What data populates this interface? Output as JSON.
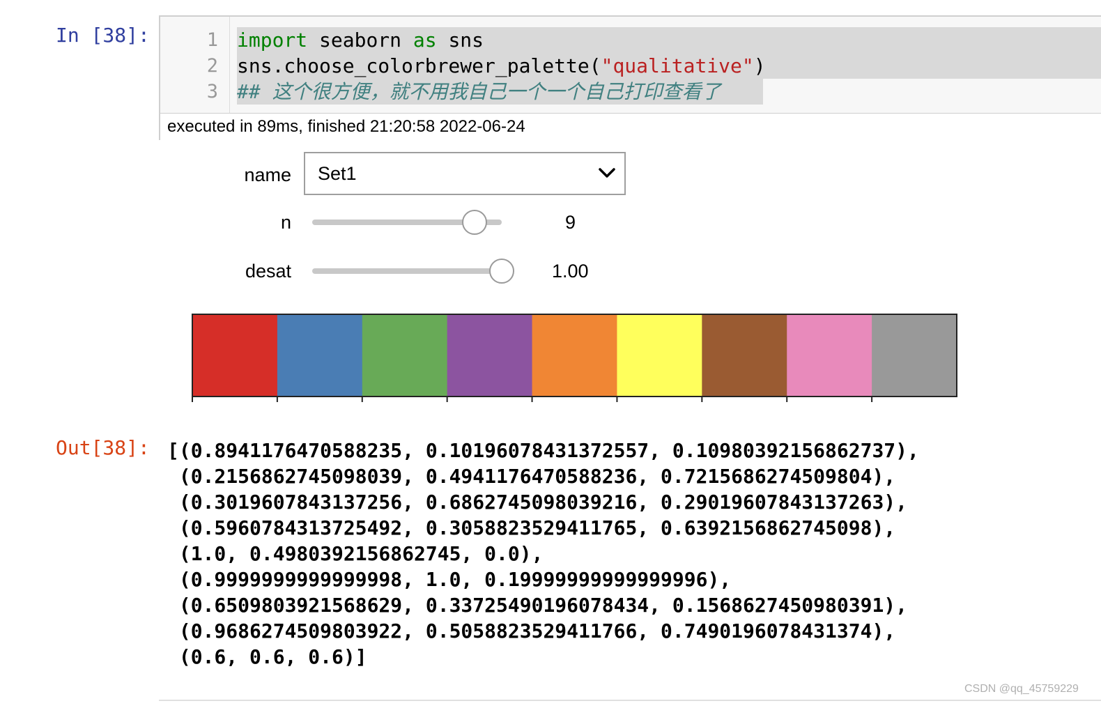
{
  "input_prompt": "In [38]:",
  "code": {
    "line_numbers": [
      "1",
      "2",
      "3"
    ],
    "line1": {
      "kw_import": "import",
      "mod": " seaborn ",
      "kw_as": "as",
      "alias": " sns"
    },
    "line2": {
      "prefix": "sns.choose_colorbrewer_palette(",
      "arg": "\"qualitative\"",
      "suffix": ")"
    },
    "line3": {
      "comment": "## 这个很方便，就不用我自己一个一个自己打印查看了"
    }
  },
  "exec_status": "executed in 89ms, finished 21:20:58 2022-06-24",
  "widgets": {
    "name": {
      "label": "name",
      "value": "Set1",
      "icon": "chevron-down-icon"
    },
    "n": {
      "label": "n",
      "value": "9",
      "min": 3,
      "max": 10,
      "level": 9
    },
    "desat": {
      "label": "desat",
      "value": "1.00",
      "min": 0,
      "max": 1,
      "level": 1.0
    }
  },
  "palette": {
    "swatches": [
      "#d62e28",
      "#4a7db4",
      "#68aa57",
      "#8c54a0",
      "#f08634",
      "#ffff5c",
      "#9a5b32",
      "#e88abb",
      "#999999"
    ],
    "frame_color": "#222222"
  },
  "output_prompt": "Out[38]:",
  "output_lines": [
    "[(0.8941176470588235, 0.10196078431372557, 0.10980392156862737),",
    " (0.2156862745098039, 0.4941176470588236, 0.7215686274509804),",
    " (0.3019607843137256, 0.6862745098039216, 0.29019607843137263),",
    " (0.5960784313725492, 0.3058823529411765, 0.6392156862745098),",
    " (1.0, 0.4980392156862745, 0.0),",
    " (0.9999999999999998, 1.0, 0.19999999999999996),",
    " (0.6509803921568629, 0.33725490196078434, 0.1568627450980391),",
    " (0.9686274509803922, 0.5058823529411766, 0.7490196078431374),",
    " (0.6, 0.6, 0.6)]"
  ],
  "watermark": "CSDN @qq_45759229"
}
